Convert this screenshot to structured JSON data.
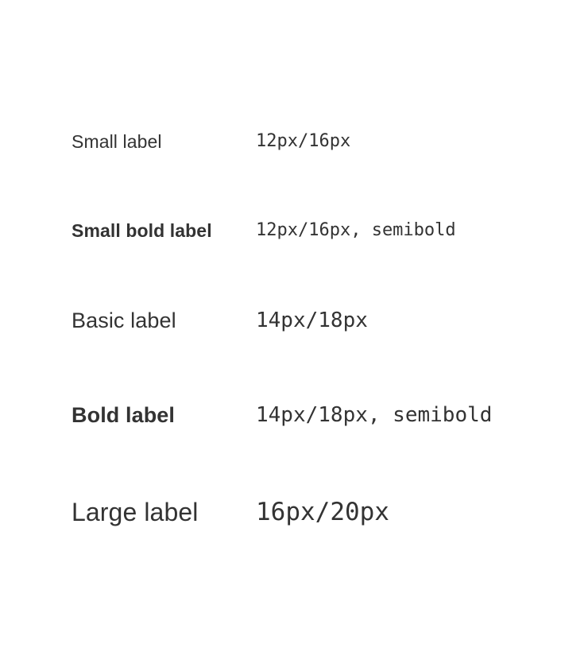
{
  "rows": [
    {
      "label": "Small label",
      "spec": "12px/16px"
    },
    {
      "label": "Small bold label",
      "spec": "12px/16px, semibold"
    },
    {
      "label": "Basic label",
      "spec": "14px/18px"
    },
    {
      "label": "Bold label",
      "spec": "14px/18px, semibold"
    },
    {
      "label": "Large label",
      "spec": "16px/20px"
    }
  ],
  "colors": {
    "text": "#333333",
    "background": "#ffffff"
  }
}
